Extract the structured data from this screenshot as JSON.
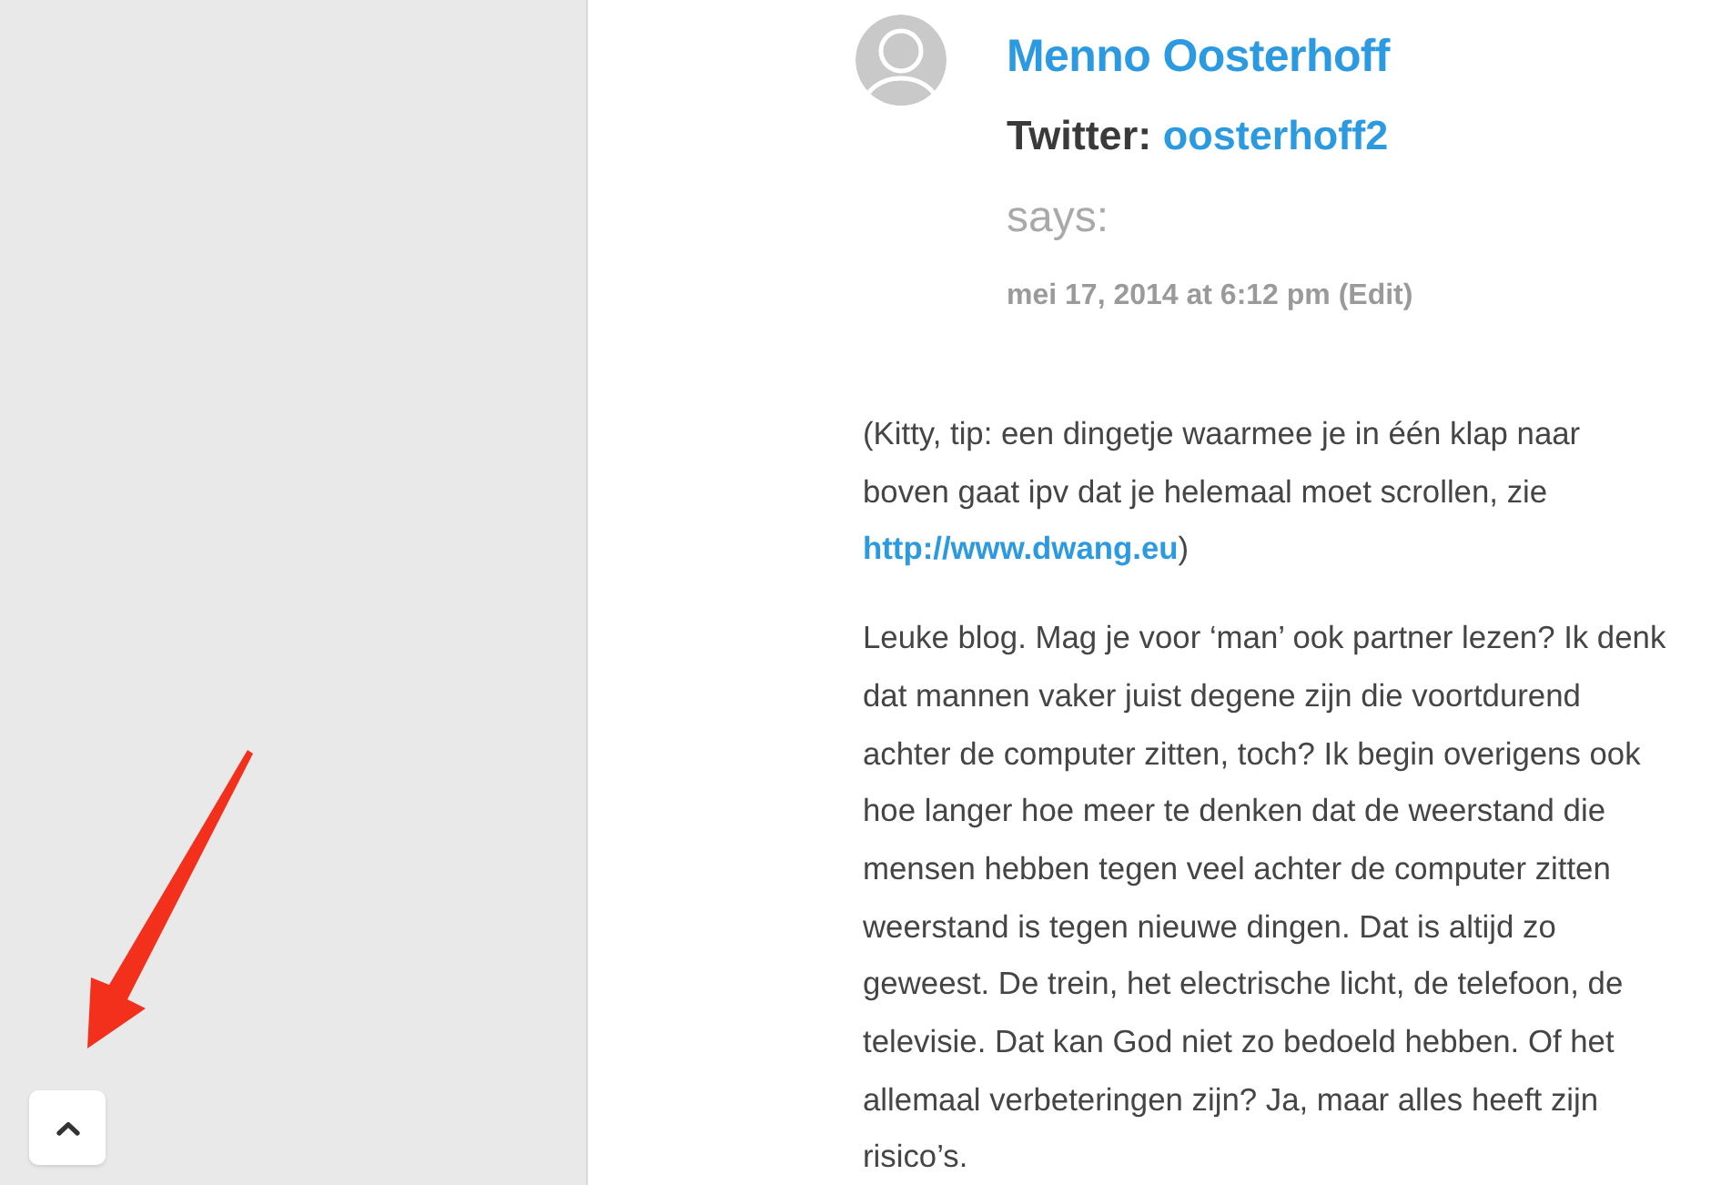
{
  "comment": {
    "author": "Menno Oosterhoff",
    "twitter_label": "Twitter:",
    "twitter_handle": "oosterhoff2",
    "says": "says:",
    "date": "mei 17, 2014 at 6:12 pm (Edit)",
    "paragraphs": [
      {
        "text": "(Kitty, tip: een dingetje waarmee je in één klap naar boven gaat ipv dat je helemaal moet scrollen, zie ",
        "link": "http://www.dwang.eu",
        "after": ")"
      },
      {
        "text": "Leuke blog. Mag je voor ‘man’ ook partner lezen? Ik denk dat mannen vaker juist degene zijn die voortdurend achter de computer zitten, toch? Ik begin overigens ook hoe langer hoe meer te denken dat de weerstand die mensen hebben tegen veel achter de computer zitten weerstand is tegen nieuwe dingen. Dat is altijd zo geweest. De trein, het electrische licht, de telefoon, de televisie. Dat kan God niet zo bedoeld hebben. Of het allemaal verbeteringen zijn? Ja, maar alles heeft zijn risico’s."
      }
    ]
  }
}
